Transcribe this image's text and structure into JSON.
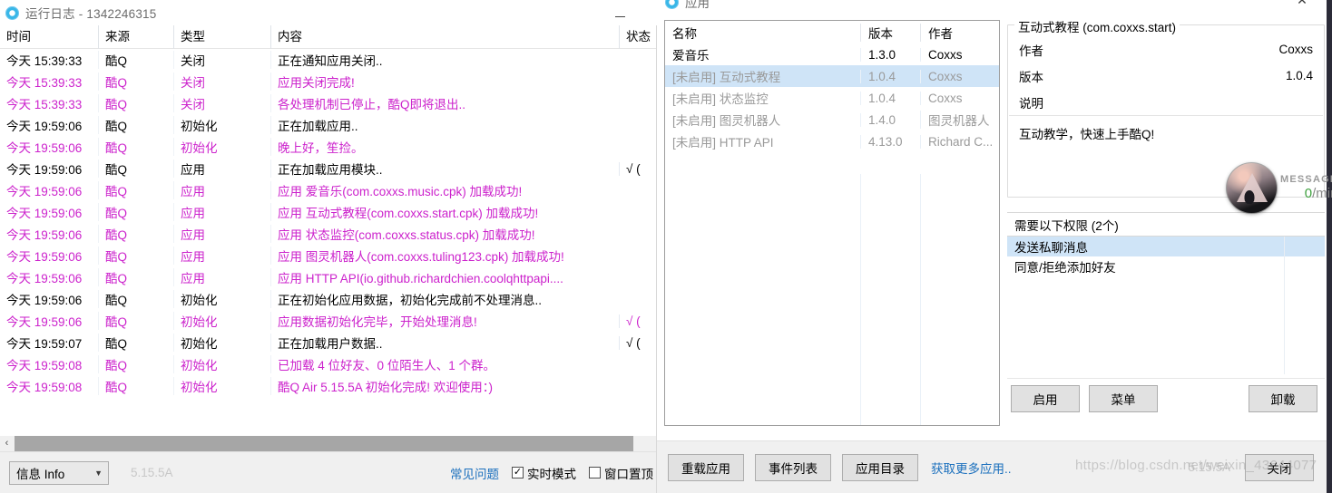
{
  "log_window": {
    "logo_icon": "coolq-logo-icon",
    "title": "运行日志 - 1342246315",
    "minimize_label": "—",
    "columns": [
      "时间",
      "来源",
      "类型",
      "内容",
      "状态"
    ],
    "rows": [
      {
        "time": "今天 15:39:33",
        "source": "酷Q",
        "type": "关闭",
        "content": "正在通知应用关闭..",
        "status": "",
        "highlight": false
      },
      {
        "time": "今天 15:39:33",
        "source": "酷Q",
        "type": "关闭",
        "content": "应用关闭完成!",
        "status": "",
        "highlight": true
      },
      {
        "time": "今天 15:39:33",
        "source": "酷Q",
        "type": "关闭",
        "content": "各处理机制已停止，酷Q即将退出..",
        "status": "",
        "highlight": true
      },
      {
        "time": "今天 19:59:06",
        "source": "酷Q",
        "type": "初始化",
        "content": "正在加载应用..",
        "status": "",
        "highlight": false
      },
      {
        "time": "今天 19:59:06",
        "source": "酷Q",
        "type": "初始化",
        "content": "晚上好，笙捡。",
        "status": "",
        "highlight": true
      },
      {
        "time": "今天 19:59:06",
        "source": "酷Q",
        "type": "应用",
        "content": "正在加载应用模块..",
        "status": "√ (",
        "highlight": false
      },
      {
        "time": "今天 19:59:06",
        "source": "酷Q",
        "type": "应用",
        "content": "应用 爱音乐(com.coxxs.music.cpk) 加载成功!",
        "status": "",
        "highlight": true
      },
      {
        "time": "今天 19:59:06",
        "source": "酷Q",
        "type": "应用",
        "content": "应用 互动式教程(com.coxxs.start.cpk) 加载成功!",
        "status": "",
        "highlight": true
      },
      {
        "time": "今天 19:59:06",
        "source": "酷Q",
        "type": "应用",
        "content": "应用 状态监控(com.coxxs.status.cpk) 加载成功!",
        "status": "",
        "highlight": true
      },
      {
        "time": "今天 19:59:06",
        "source": "酷Q",
        "type": "应用",
        "content": "应用 图灵机器人(com.coxxs.tuling123.cpk) 加载成功!",
        "status": "",
        "highlight": true
      },
      {
        "time": "今天 19:59:06",
        "source": "酷Q",
        "type": "应用",
        "content": "应用 HTTP API(io.github.richardchien.coolqhttpapi....",
        "status": "",
        "highlight": true
      },
      {
        "time": "今天 19:59:06",
        "source": "酷Q",
        "type": "初始化",
        "content": "正在初始化应用数据，初始化完成前不处理消息..",
        "status": "",
        "highlight": false
      },
      {
        "time": "今天 19:59:06",
        "source": "酷Q",
        "type": "初始化",
        "content": "应用数据初始化完毕，开始处理消息!",
        "status": "√ (",
        "highlight": true
      },
      {
        "time": "今天 19:59:07",
        "source": "酷Q",
        "type": "初始化",
        "content": "正在加载用户数据..",
        "status": "√ (",
        "highlight": false
      },
      {
        "time": "今天 19:59:08",
        "source": "酷Q",
        "type": "初始化",
        "content": "已加载 4 位好友、0 位陌生人、1 个群。",
        "status": "",
        "highlight": true
      },
      {
        "time": "今天 19:59:08",
        "source": "酷Q",
        "type": "初始化",
        "content": "酷Q Air 5.15.5A 初始化完成! 欢迎使用：)",
        "status": "",
        "highlight": true
      }
    ],
    "statusbar": {
      "level_select": "信息 Info",
      "chevron_icon": "chevron-down-icon",
      "version": "5.15.5A",
      "faq_link": "常见问题",
      "realtime_label": "实时模式",
      "realtime_checked": true,
      "realtime_check_glyph": "✓",
      "ontop_label": "窗口置顶",
      "ontop_checked": false,
      "ontop_check_glyph": ""
    },
    "scrollbar": {
      "left_arrow_glyph": "‹"
    }
  },
  "app_window": {
    "logo_icon": "coolq-logo-icon",
    "title": "应用",
    "close_icon": "close-icon",
    "close_glyph": "✕",
    "list": {
      "columns": [
        "名称",
        "版本",
        "作者"
      ],
      "rows": [
        {
          "name": "爱音乐",
          "version": "1.3.0",
          "author": "Coxxs",
          "enabled": true,
          "selected": false
        },
        {
          "name": "[未启用] 互动式教程",
          "version": "1.0.4",
          "author": "Coxxs",
          "enabled": false,
          "selected": true
        },
        {
          "name": "[未启用] 状态监控",
          "version": "1.0.4",
          "author": "Coxxs",
          "enabled": false,
          "selected": false
        },
        {
          "name": "[未启用] 图灵机器人",
          "version": "1.4.0",
          "author": "图灵机器人",
          "enabled": false,
          "selected": false
        },
        {
          "name": "[未启用] HTTP API",
          "version": "4.13.0",
          "author": "Richard C...",
          "enabled": false,
          "selected": false
        }
      ]
    },
    "detail": {
      "group_title": "互动式教程 (com.coxxs.start)",
      "author_label": "作者",
      "author_value": "Coxxs",
      "version_label": "版本",
      "version_value": "1.0.4",
      "desc_label": "说明",
      "desc_value": "互动教学，快速上手酷Q!",
      "permissions_header": "需要以下权限 (2个)",
      "permissions": [
        {
          "label": "发送私聊消息",
          "selected": true
        },
        {
          "label": "同意/拒绝添加好友",
          "selected": false
        }
      ],
      "buttons": {
        "enable": "启用",
        "menu": "菜单",
        "uninstall": "卸载"
      }
    },
    "bottom": {
      "reload": "重载应用",
      "events": "事件列表",
      "directory": "应用目录",
      "more_link": "获取更多应用..",
      "version": "5.15.5A",
      "close": "关闭"
    }
  },
  "message_widget": {
    "avatar_icon": "user-avatar",
    "label": "MESSAGE",
    "rate_value": "0",
    "rate_unit": "/min"
  },
  "watermark": {
    "text": "https://blog.csdn.net/weixin_43644077"
  },
  "colors": {
    "highlight_magenta": "#cc22cc",
    "selection_blue": "#cfe4f7",
    "link_blue": "#1a6fbd",
    "chrome_gray": "#f0f0f0",
    "logo_cyan": "#39b7e8",
    "rate_green": "#3fa13f"
  }
}
